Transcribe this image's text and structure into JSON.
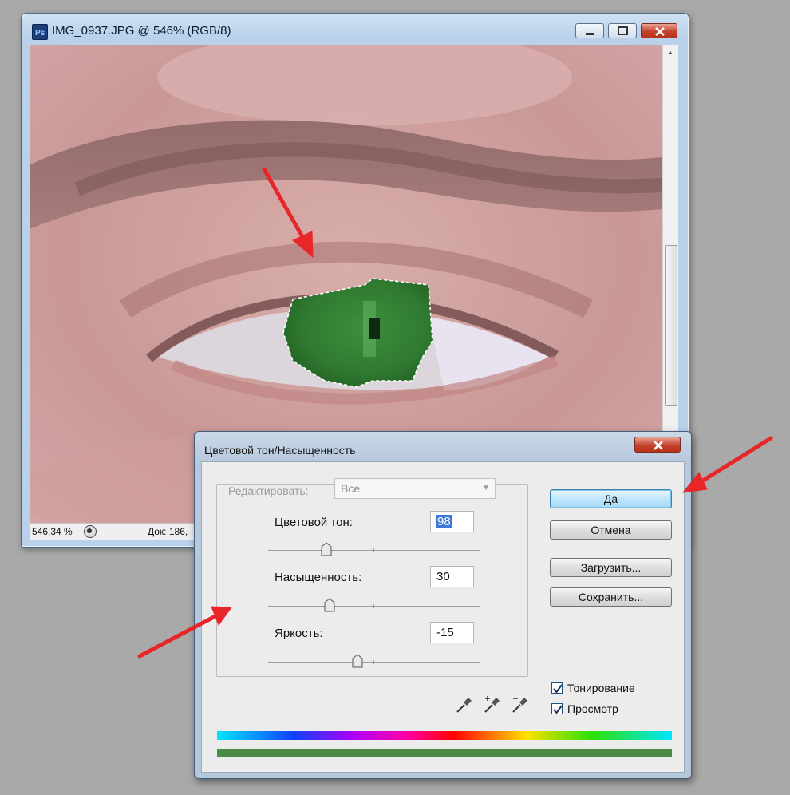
{
  "document_window": {
    "title": "IMG_0937.JPG @ 546% (RGB/8)",
    "status_zoom": "546,34 %",
    "status_doc": "Док: 186,"
  },
  "dialog": {
    "title": "Цветовой тон/Насыщенность",
    "edit_label": "Редактировать:",
    "edit_select_value": "Все",
    "hue": {
      "label": "Цветовой тон:",
      "value": "98"
    },
    "saturation": {
      "label": "Насыщенность:",
      "value": "30"
    },
    "lightness": {
      "label": "Яркость:",
      "value": "-15"
    },
    "buttons": {
      "ok": "Да",
      "cancel": "Отмена",
      "load": "Загрузить...",
      "save": "Сохранить..."
    },
    "colorize": {
      "label": "Тонирование",
      "checked": true
    },
    "preview": {
      "label": "Просмотр",
      "checked": true
    }
  },
  "colors": {
    "accent_selection": "#3b79d8",
    "annotation_arrow": "#e8262a",
    "shifted_hue_bar": "#4a8a44"
  },
  "icons": [
    "photoshop-app-icon",
    "minimize-icon",
    "maximize-icon",
    "close-icon",
    "eyedropper-icon",
    "eyedropper-plus-icon",
    "eyedropper-minus-icon",
    "checkmark-icon",
    "dropdown-caret-icon"
  ]
}
